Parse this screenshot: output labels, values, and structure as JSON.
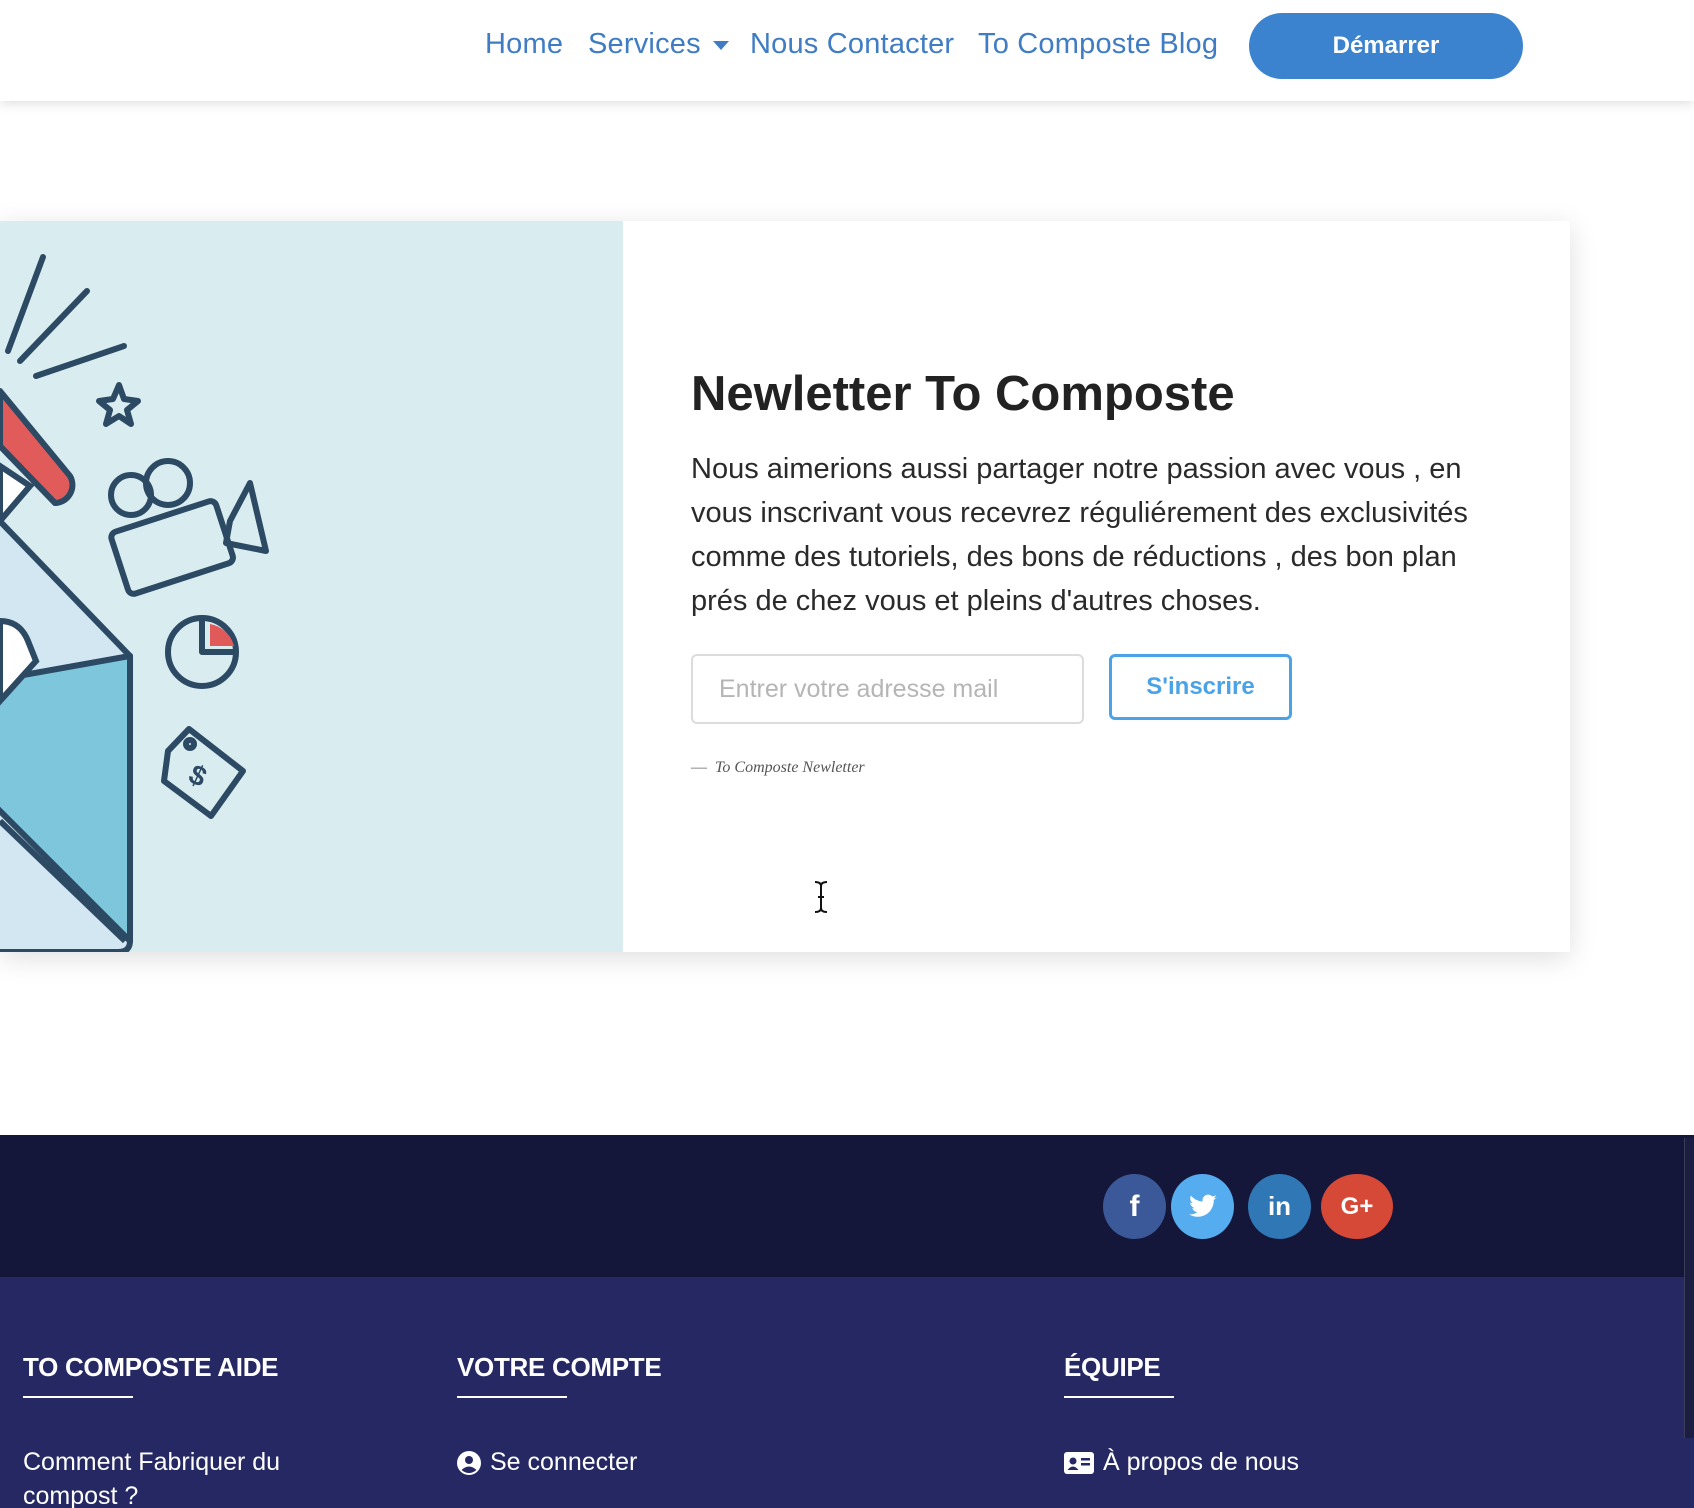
{
  "header": {
    "nav": {
      "home": "Home",
      "services": "Services",
      "contact": "Nous Contacter",
      "blog": "To Composte Blog"
    },
    "cta_label": "Démarrer"
  },
  "newsletter": {
    "title": "Newletter To Composte",
    "text": "Nous aimerions aussi partager notre passion avec vous , en vous inscrivant vous recevrez réguliérement des exclusivités comme des tutoriels, des bons de réductions , des bon plan prés de chez vous et pleins d'autres choses.",
    "email_placeholder": "Entrer votre adresse mail",
    "email_value": "",
    "subscribe_label": "S'inscrire",
    "caption_dash": "—",
    "caption": "To Composte Newletter"
  },
  "social": {
    "facebook": "f",
    "twitter": "twitter-bird-icon",
    "linkedin": "in",
    "google": "G+",
    "colors": {
      "facebook": "#3b5998",
      "twitter": "#55acee",
      "linkedin": "#2f77b5",
      "google": "#d64937"
    }
  },
  "footer": {
    "col1": {
      "title": "TO COMPOSTE AIDE",
      "link1_line1": "Comment Fabriquer du",
      "link1_line2": "compost ?"
    },
    "col2": {
      "title": "VOTRE COMPTE",
      "link1": "Se connecter"
    },
    "col3": {
      "title": "ÉQUIPE",
      "link1": "À propos de nous"
    }
  },
  "colors": {
    "accent": "#3b83cf",
    "nav_link": "#3f7cc4",
    "footer_top": "#14173a",
    "footer_main": "#252863",
    "illustration_bg": "#d9ecf0"
  }
}
